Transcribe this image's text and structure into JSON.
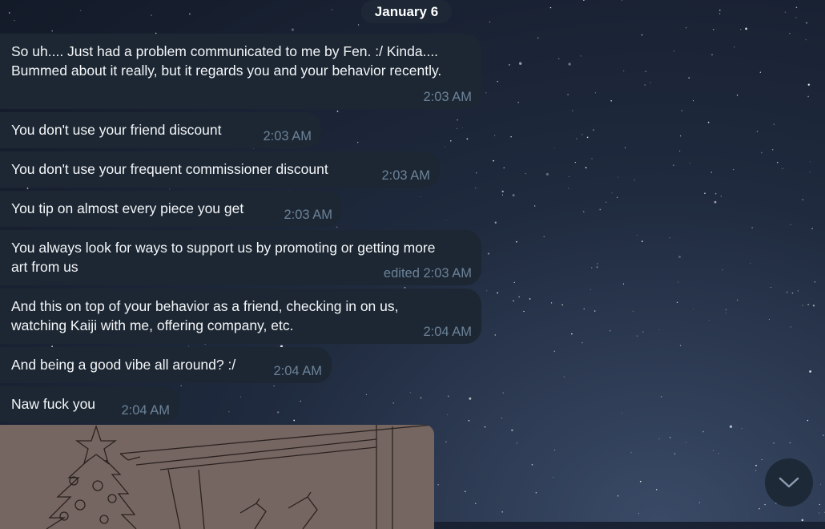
{
  "date_separator": "January 6",
  "messages": [
    {
      "text": "So uh.... Just had a problem communicated to me by Fen. :/ Kinda.... Bummed about it really, but it regards you and your behavior recently.",
      "time": "2:03 AM"
    },
    {
      "text": "You don't use your friend discount",
      "time": "2:03 AM"
    },
    {
      "text": "You don't use your frequent commissioner discount",
      "time": "2:03 AM"
    },
    {
      "text": "You tip on almost every piece you get",
      "time": "2:03 AM"
    },
    {
      "text": "You always look for ways to support us by promoting or getting more art from us",
      "time": "edited 2:03 AM"
    },
    {
      "text": "And this on top of your behavior as a friend, checking in on us, watching Kaiji with me, offering company, etc.",
      "time": "2:04 AM"
    },
    {
      "text": "And being a good vibe all around? :/",
      "time": "2:04 AM"
    },
    {
      "text": "Naw fuck you",
      "time": "2:04 AM"
    }
  ],
  "scroll_down_button": {
    "icon": "chevron-down-icon"
  },
  "colors": {
    "bubble": "#1c2733",
    "text": "#f4f6f8",
    "meta": "#6d8298",
    "photo_bg": "#766661"
  }
}
